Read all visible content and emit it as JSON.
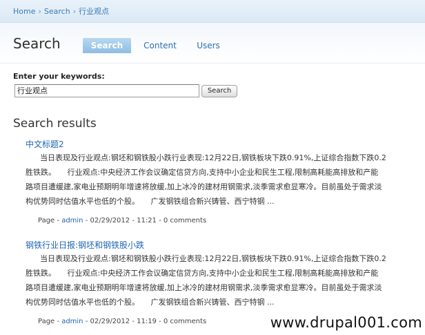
{
  "breadcrumb": {
    "items": [
      "Home",
      "Search",
      "行业观点"
    ],
    "separator": "›"
  },
  "header": {
    "title": "Search",
    "tabs": [
      {
        "label": "Search",
        "active": true
      },
      {
        "label": "Content",
        "active": false
      },
      {
        "label": "Users",
        "active": false
      }
    ]
  },
  "form": {
    "label": "Enter your keywords:",
    "keywords_value": "行业观点",
    "button_label": "Search"
  },
  "results": {
    "heading": "Search results",
    "items": [
      {
        "title": "中文标题2",
        "snippet_lines": [
          "当日表现及行业观点:钢坯和钢铁股小跌行业表现:12月22日,钢铁板块下跌0.91%,上证综合指数下跌0.2",
          "胜铁跌。　　行业观点:中央经济工作会议确定信贷方向,支持中小企业和民生工程,限制高耗能高排放和产能",
          "路项目遭缓建,家电业预期明年增速将放缓,加上冰冷的建材用钢需求,淡季需求愈显寒冷。目前虽处于需求淡",
          "构优势同时估值水平也低的个股。　　广发钢铁组合新兴铸管、西宁特钢 ..."
        ],
        "meta": {
          "type": "Page",
          "author": "admin",
          "date": "02/29/2012 - 11:21",
          "comments": "0 comments"
        }
      },
      {
        "title": "钢铁行业日报:钢坯和钢铁股小跌",
        "snippet_lines": [
          "当日表现及行业观点:钢坯和钢铁股小跌行业表现:12月22日,钢铁板块下跌0.91%,上证综合指数下跌0.2",
          "胜铁跌。　　行业观点:中央经济工作会议确定信贷方向,支持中小企业和民生工程,限制高耗能高排放和产能",
          "路项目遭缓建,家电业预期明年增速将放缓,加上冰冷的建材用钢需求,淡季需求愈显寒冷。目前虽处于需求淡",
          "构优势同时估值水平也低的个股。　　广发钢铁组合新兴铸管、西宁特钢 ..."
        ],
        "meta": {
          "type": "Page",
          "author": "admin",
          "date": "02/29/2012 - 11:19",
          "comments": "0 comments"
        }
      }
    ]
  },
  "watermark": "www.drupal001.com"
}
